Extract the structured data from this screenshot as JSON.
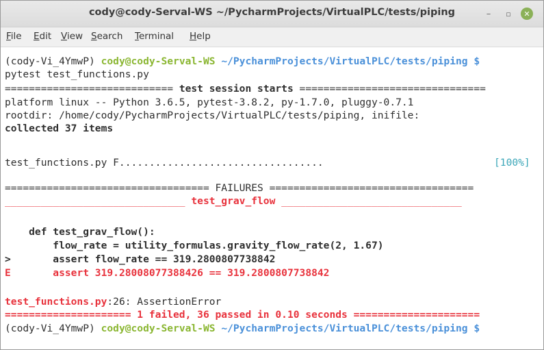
{
  "window": {
    "title": "cody@cody-Serval-WS ~/PycharmProjects/VirtualPLC/tests/piping",
    "controls": {
      "minimize": "–",
      "maximize": "▫",
      "close": "✕"
    }
  },
  "menu": [
    {
      "first": "F",
      "rest": "ile"
    },
    {
      "first": "E",
      "rest": "dit"
    },
    {
      "first": "V",
      "rest": "iew"
    },
    {
      "first": "S",
      "rest": "earch"
    },
    {
      "first": "T",
      "rest": "erminal"
    },
    {
      "first": "H",
      "rest": "elp"
    }
  ],
  "terminal": {
    "prompt1": {
      "env": "(cody-Vi_4YmwP) ",
      "user": "cody@cody-Serval-WS",
      "path": " ~/PycharmProjects/VirtualPLC/tests/piping $"
    },
    "command": "pytest test_functions.py",
    "session_sep_left": "============================ ",
    "session_title": "test session starts",
    "session_sep_right": " ===============================",
    "platform": "platform linux -- Python 3.6.5, pytest-3.8.2, py-1.7.0, pluggy-0.7.1",
    "rootdir": "rootdir: /home/cody/PycharmProjects/VirtualPLC/tests/piping, inifile:",
    "collected": "collected 37 items",
    "progress_left": "test_functions.py F..................................",
    "progress_pct": "[100%]",
    "failures_sep": "================================== FAILURES ==================================",
    "fail_sep_left": "______________________________ ",
    "fail_name": "test_grav_flow",
    "fail_sep_right": " ______________________________",
    "code_def": "    def test_grav_flow():",
    "code_flow": "        flow_rate = utility_formulas.gravity_flow_rate(2, 1.67)",
    "code_marker": ">",
    "code_assert": "       assert flow_rate == 319.2800807738842",
    "err_marker": "E",
    "err_assert": "       assert 319.28008077388426 == 319.2800807738842",
    "error_file": "test_functions.py",
    "error_rest": ":26: AssertionError",
    "summary": "===================== 1 failed, 36 passed in 0.10 seconds =====================",
    "prompt2": {
      "env": "(cody-Vi_4YmwP) ",
      "user": "cody@cody-Serval-WS",
      "path": " ~/PycharmProjects/VirtualPLC/tests/piping $"
    }
  },
  "colors": {
    "prompt_user": "#8ab631",
    "prompt_path": "#4a90d9",
    "error_red": "#e8323c",
    "progress_cyan": "#3aa6b8",
    "close_button": "#8bb158"
  }
}
